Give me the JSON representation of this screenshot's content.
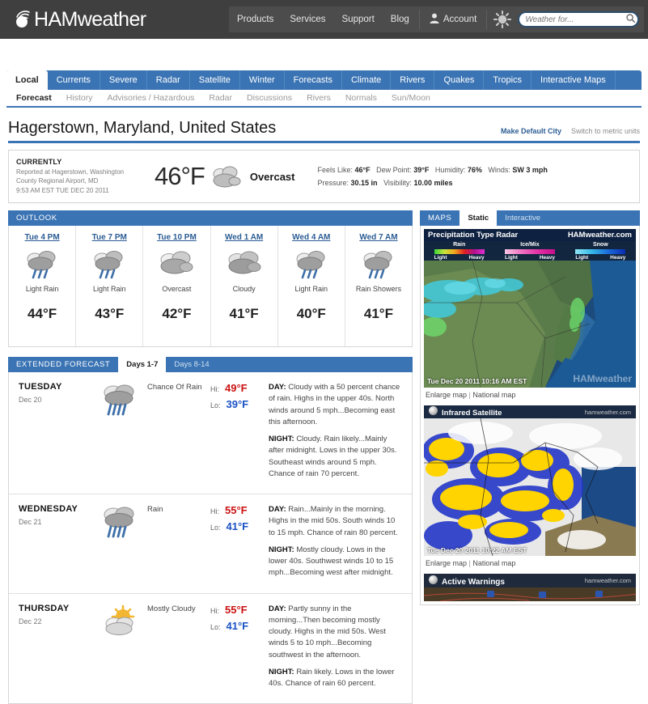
{
  "brand": {
    "name": "HAMweather",
    "logo_icon": "signal-dot-logo"
  },
  "topnav": {
    "links": [
      "Products",
      "Services",
      "Support",
      "Blog"
    ],
    "account_label": "Account",
    "account_icon": "user-icon",
    "sun_icon": "sun-icon",
    "search": {
      "placeholder": "Weather for...",
      "value": "",
      "icon": "search-icon"
    }
  },
  "mainnav": {
    "tabs": [
      {
        "label": "Local",
        "active": true
      },
      {
        "label": "Currents",
        "active": false
      },
      {
        "label": "Severe",
        "active": false
      },
      {
        "label": "Radar",
        "active": false
      },
      {
        "label": "Satellite",
        "active": false
      },
      {
        "label": "Winter",
        "active": false
      },
      {
        "label": "Forecasts",
        "active": false
      },
      {
        "label": "Climate",
        "active": false
      },
      {
        "label": "Rivers",
        "active": false
      },
      {
        "label": "Quakes",
        "active": false
      },
      {
        "label": "Tropics",
        "active": false
      },
      {
        "label": "Interactive Maps",
        "active": false
      }
    ]
  },
  "subnav": {
    "items": [
      {
        "label": "Forecast",
        "active": true
      },
      {
        "label": "History",
        "active": false
      },
      {
        "label": "Advisories / Hazardous",
        "active": false
      },
      {
        "label": "Radar",
        "active": false
      },
      {
        "label": "Discussions",
        "active": false
      },
      {
        "label": "Rivers",
        "active": false
      },
      {
        "label": "Normals",
        "active": false
      },
      {
        "label": "Sun/Moon",
        "active": false
      }
    ]
  },
  "page": {
    "title": "Hagerstown, Maryland, United States",
    "make_default_link": "Make Default City",
    "metric_link": "Switch to metric units"
  },
  "currently": {
    "label": "CURRENTLY",
    "reported_line1": "Reported at Hagerstown, Washington",
    "reported_line2": "County Regional Airport, MD",
    "observed_at": "9:53 AM EST TUE DEC 20 2011",
    "temperature": "46°F",
    "condition": "Overcast",
    "condition_icon": "overcast-cloud-icon",
    "stats_line1": [
      {
        "label": "Feels Like:",
        "value": "46°F"
      },
      {
        "label": "Dew Point:",
        "value": "39°F"
      },
      {
        "label": "Humidity:",
        "value": "76%"
      },
      {
        "label": "Winds:",
        "value": "SW 3 mph"
      }
    ],
    "stats_line2": [
      {
        "label": "Pressure:",
        "value": "30.15 in"
      },
      {
        "label": "Visibility:",
        "value": "10.00 miles"
      }
    ]
  },
  "outlook": {
    "header": "OUTLOOK",
    "cells": [
      {
        "time": "Tue 4 PM",
        "condition": "Light Rain",
        "icon": "rain-cloud-icon",
        "temp": "44°F"
      },
      {
        "time": "Tue 7 PM",
        "condition": "Light Rain",
        "icon": "rain-cloud-icon",
        "temp": "43°F"
      },
      {
        "time": "Tue 10 PM",
        "condition": "Overcast",
        "icon": "overcast-cloud-icon",
        "temp": "42°F"
      },
      {
        "time": "Wed 1 AM",
        "condition": "Cloudy",
        "icon": "cloudy-icon",
        "temp": "41°F"
      },
      {
        "time": "Wed 4 AM",
        "condition": "Light Rain",
        "icon": "rain-cloud-icon",
        "temp": "40°F"
      },
      {
        "time": "Wed 7 AM",
        "condition": "Rain Showers",
        "icon": "rain-cloud-icon",
        "temp": "41°F"
      }
    ]
  },
  "extended": {
    "header": "EXTENDED FORECAST",
    "tabs": [
      {
        "label": "Days 1-7",
        "active": true
      },
      {
        "label": "Days 8-14",
        "active": false
      }
    ],
    "hi_label": "Hi:",
    "lo_label": "Lo:",
    "days": [
      {
        "day": "TUESDAY",
        "date": "Dec 20",
        "condition": "Chance Of Rain",
        "icon": "rain-cloud-icon",
        "hi": "49°F",
        "lo": "39°F",
        "day_prefix": "DAY:",
        "day_text": "Cloudy with a 50 percent chance of rain. Highs in the upper 40s. North winds around 5 mph...Becoming east this afternoon.",
        "night_prefix": "NIGHT:",
        "night_text": "Cloudy. Rain likely...Mainly after midnight. Lows in the upper 30s. Southeast winds around 5 mph. Chance of rain 70 percent."
      },
      {
        "day": "WEDNESDAY",
        "date": "Dec 21",
        "condition": "Rain",
        "icon": "rain-cloud-icon",
        "hi": "55°F",
        "lo": "41°F",
        "day_prefix": "DAY:",
        "day_text": "Rain...Mainly in the morning. Highs in the mid 50s. South winds 10 to 15 mph. Chance of rain 80 percent.",
        "night_prefix": "NIGHT:",
        "night_text": "Mostly cloudy. Lows in the lower 40s. Southwest winds 10 to 15 mph...Becoming west after midnight."
      },
      {
        "day": "THURSDAY",
        "date": "Dec 22",
        "condition": "Mostly Cloudy",
        "icon": "sun-behind-cloud-icon",
        "hi": "55°F",
        "lo": "41°F",
        "day_prefix": "DAY:",
        "day_text": "Partly sunny in the morning...Then becoming mostly cloudy. Highs in the mid 50s. West winds 5 to 10 mph...Becoming southwest in the afternoon.",
        "night_prefix": "NIGHT:",
        "night_text": "Rain likely. Lows in the lower 40s. Chance of rain 60 percent."
      }
    ]
  },
  "maps": {
    "header": "MAPS",
    "tabs": [
      {
        "label": "Static",
        "active": true
      },
      {
        "label": "Interactive",
        "active": false
      }
    ],
    "radar": {
      "title": "Precipitation Type Radar",
      "brand": "HAMweather.com",
      "legend": [
        {
          "name": "Rain",
          "light": "Light",
          "heavy": "Heavy"
        },
        {
          "name": "Ice/Mix",
          "light": "Light",
          "heavy": "Heavy"
        },
        {
          "name": "Snow",
          "light": "Light",
          "heavy": "Heavy"
        }
      ],
      "timestamp": "Tue Dec 20 2011 10:16 AM EST",
      "watermark": "HAMweather",
      "enlarge_link": "Enlarge map",
      "national_link": "National map",
      "link_separator": " | "
    },
    "satellite": {
      "title": "Infrared Satellite",
      "brand": "hamweather.com",
      "timestamp": "Tue Dec 20 2011 10:22 AM EST",
      "enlarge_link": "Enlarge map",
      "national_link": "National map",
      "link_separator": " | "
    },
    "warnings": {
      "title": "Active Warnings",
      "brand": "hamweather.com"
    }
  },
  "colors": {
    "accent_blue": "#3b74b4",
    "topbar_dark": "#3f3f3f",
    "hi_red": "#cc1111",
    "lo_blue": "#1a51c4",
    "link_blue": "#2b5c93"
  }
}
